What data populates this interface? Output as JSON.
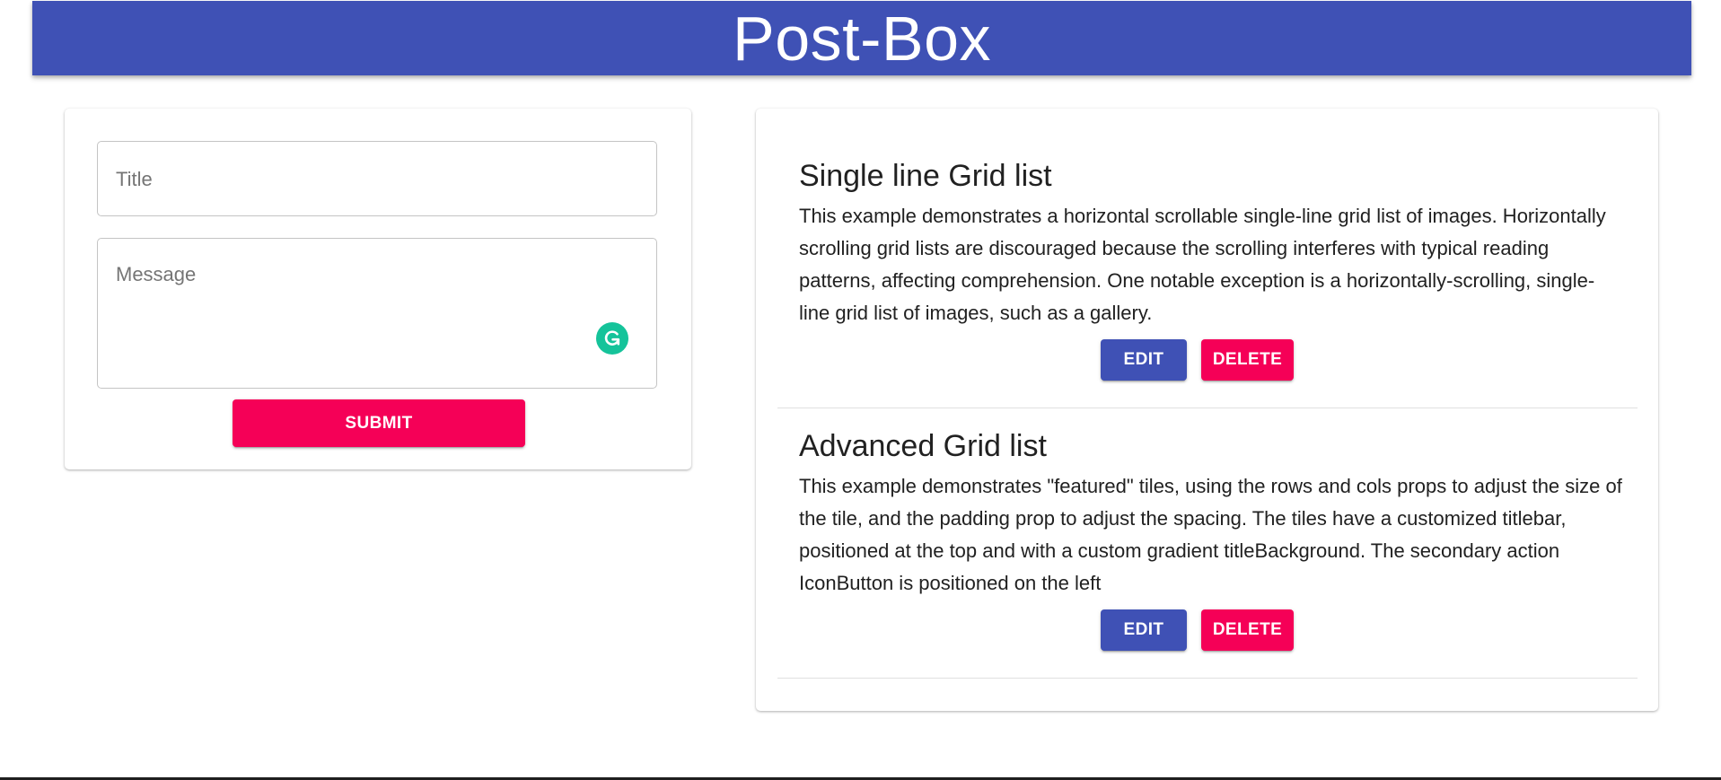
{
  "header": {
    "title": "Post-Box"
  },
  "form": {
    "title_placeholder": "Title",
    "message_placeholder": "Message",
    "submit_label": "SUBMIT"
  },
  "posts": [
    {
      "title": "Single line Grid list",
      "body": "This example demonstrates a horizontal scrollable single-line grid list of images. Horizontally scrolling grid lists are discouraged because the scrolling interferes with typical reading patterns, affecting comprehension. One notable exception is a horizontally-scrolling, single-line grid list of images, such as a gallery.",
      "edit_label": "EDIT",
      "delete_label": "DELETE"
    },
    {
      "title": "Advanced Grid list",
      "body": "This example demonstrates \"featured\" tiles, using the rows and cols props to adjust the size of the tile, and the padding prop to adjust the spacing. The tiles have a customized titlebar, positioned at the top and with a custom gradient titleBackground. The secondary action IconButton is positioned on the left",
      "edit_label": "EDIT",
      "delete_label": "DELETE"
    }
  ],
  "icons": {
    "grammarly": "grammarly-icon"
  },
  "colors": {
    "primary": "#3f51b5",
    "secondary": "#f50057",
    "grammarly": "#15c39a"
  }
}
